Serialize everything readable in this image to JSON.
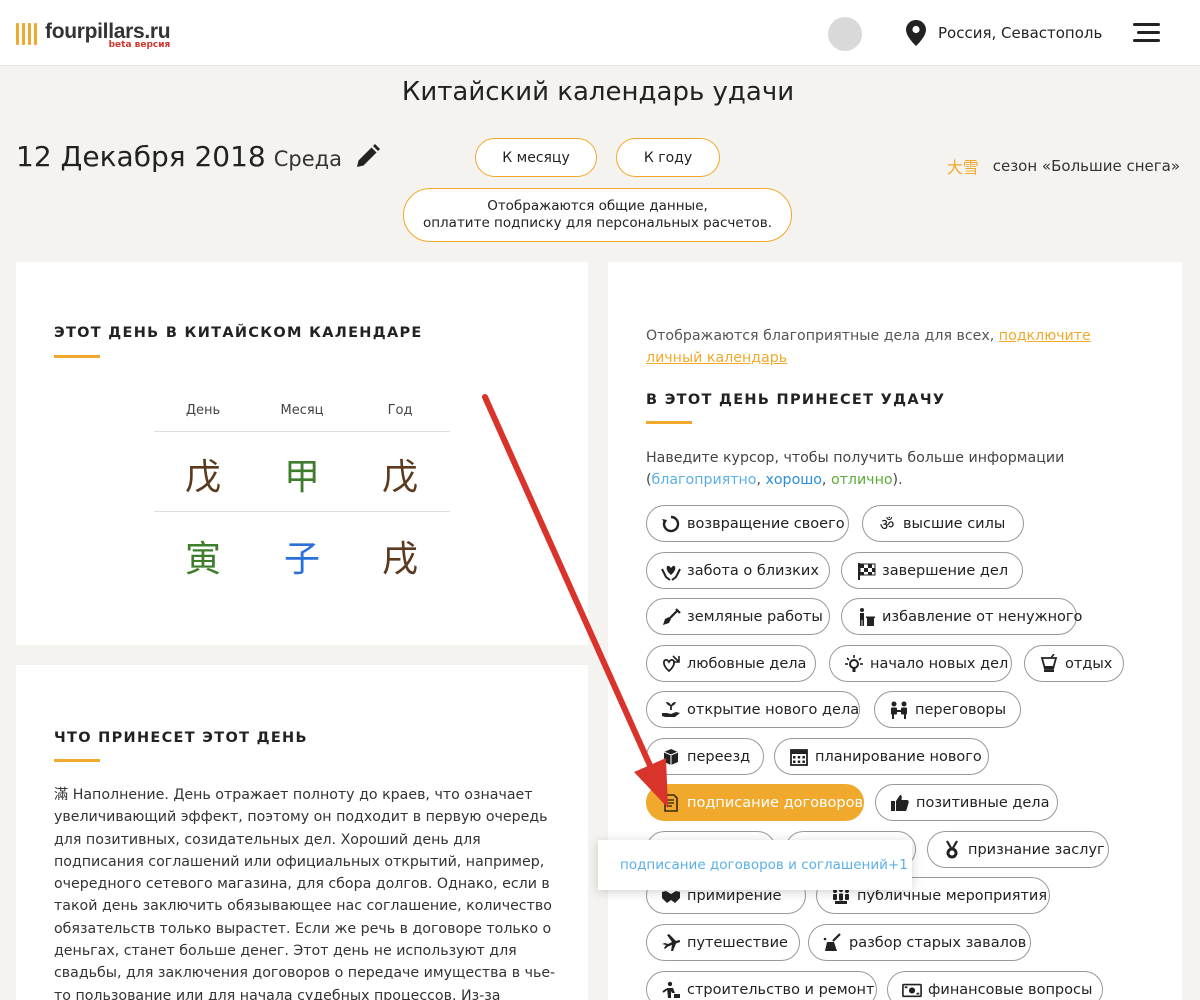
{
  "header": {
    "logo_name": "fourpillars.ru",
    "logo_beta": "beta версия",
    "location": "Россия, Севастополь",
    "brand_color": "#f0a92c"
  },
  "title": "Китайский календарь удачи",
  "date": {
    "main": "12 Декабря 2018",
    "weekday": "Среда"
  },
  "buttons": {
    "month": "К месяцу",
    "year": "К году",
    "subscribe_line1": "Отображаются общие данные,",
    "subscribe_line2": "оплатите подписку для персональных расчетов."
  },
  "season": {
    "char": "大雪",
    "text": "сезон «Большие снега»"
  },
  "calendar": {
    "title": "ЭТОТ ДЕНЬ В КИТАЙСКОМ КАЛЕНДАРЕ",
    "headers": [
      "День",
      "Месяц",
      "Год"
    ],
    "row1": [
      "戊",
      "甲",
      "戊"
    ],
    "row2": [
      "寅",
      "子",
      "戌"
    ],
    "colors": {
      "brown": "#5b3a1e",
      "green": "#3e7d2c",
      "blue": "#2b6fd9"
    }
  },
  "day_info": {
    "title": "ЧТО ПРИНЕСЕТ ЭТОТ ДЕНЬ",
    "text": "滿 Наполнение. День отражает полноту до краев, что означает увеличивающий эффект, поэтому он подходит в первую очередь для позитивных, созидательных дел. Хороший день для подписания соглашений или официальных открытий, например, очередного сетевого магазина, для сбора долгов. Однако, если в такой день заключить обязывающее нас соглашение, количество обязательств только вырастет. Если же речь в договоре только о деньгах, станет больше денег. Этот день не используют для свадьбы, для заключения договоров о передаче имущества в чье-то пользование или для начала судебных процессов. Из-за чрезмерной силы ци все может пойти не по"
  },
  "luck": {
    "note_prefix": "Отображаются благоприятные дела для всех, ",
    "note_link": "подключите личный календарь",
    "title": "В ЭТОТ ДЕНЬ ПРИНЕСЕТ УДАЧУ",
    "hover_prefix": "Наведите курсор, чтобы получить больше информации (",
    "legend1": "благоприятно",
    "legend2": "хорошо",
    "legend3": "отлично",
    "sep": ", ",
    "hover_suffix": ").",
    "tags": [
      {
        "label": "возвращение своего",
        "icon": "refresh-icon"
      },
      {
        "label": "высшие силы",
        "icon": "om-icon"
      },
      {
        "label": "забота о близких",
        "icon": "hands-heart-icon"
      },
      {
        "label": "завершение дел",
        "icon": "finish-flag-icon"
      },
      {
        "label": "земляные работы",
        "icon": "shovel-icon"
      },
      {
        "label": "избавление от ненужного",
        "icon": "trash-person-icon"
      },
      {
        "label": "любовные дела",
        "icon": "hearts-icon"
      },
      {
        "label": "начало новых дел",
        "icon": "idea-icon"
      },
      {
        "label": "отдых",
        "icon": "cocktail-icon"
      },
      {
        "label": "открытие нового дела",
        "icon": "sprout-hand-icon"
      },
      {
        "label": "переговоры",
        "icon": "people-icon"
      },
      {
        "label": "переезд",
        "icon": "box-icon"
      },
      {
        "label": "планирование нового",
        "icon": "calendar-icon"
      },
      {
        "label": "подписание договоров",
        "icon": "document-icon"
      },
      {
        "label": "позитивные дела",
        "icon": "thumbs-up-icon"
      },
      {
        "label": "",
        "icon": ""
      },
      {
        "label": "",
        "icon": ""
      },
      {
        "label": "признание заслуг",
        "icon": "medal-icon"
      },
      {
        "label": "примирение",
        "icon": "handshake-icon"
      },
      {
        "label": "публичные мероприятия",
        "icon": "crowd-icon"
      },
      {
        "label": "путешествие",
        "icon": "airplane-icon"
      },
      {
        "label": "разбор старых завалов",
        "icon": "sweep-icon"
      },
      {
        "label": "строительство и ремонт",
        "icon": "construction-icon"
      },
      {
        "label": "финансовые вопросы",
        "icon": "money-icon"
      }
    ],
    "tooltip": "подписание договоров и соглашений+1"
  }
}
